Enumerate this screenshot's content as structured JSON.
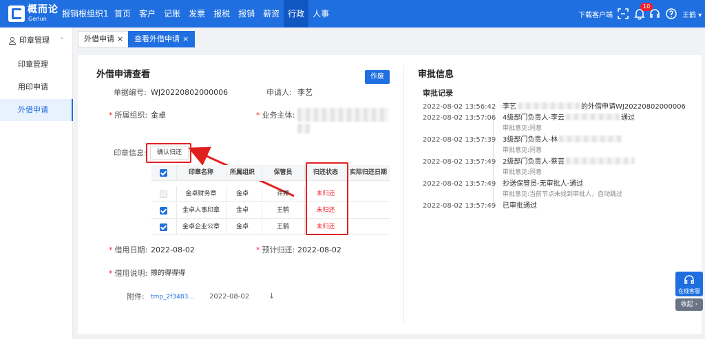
{
  "header": {
    "logo_text": "概而论",
    "logo_sub": "Gerlun",
    "org": "报销根组织1",
    "nav": [
      "首页",
      "客户",
      "记账",
      "发票",
      "报税",
      "报销",
      "薪资",
      "行政",
      "人事"
    ],
    "active_nav": "行政",
    "download": "下载客户端",
    "notif_count": "10",
    "user": "王鹤",
    "brand_color": "#1f6fe0"
  },
  "sidebar": {
    "group": "印章管理",
    "items": [
      "印章管理",
      "用印申请",
      "外借申请"
    ],
    "active": "外借申请"
  },
  "tabs": [
    {
      "label": "外借申请",
      "close": "×"
    },
    {
      "label": "查看外借申请",
      "close": "×"
    }
  ],
  "form": {
    "title": "外借申请查看",
    "void_button": "作废",
    "doc_no_label": "单据编号:",
    "doc_no": "WJ20220802000006",
    "applicant_label": "申请人:",
    "applicant": "李艺",
    "org_label": "所属组织:",
    "org": "金卓",
    "entity_label": "业务主体:",
    "seal_label": "印章信息:",
    "confirm_return": "确认归还",
    "borrow_date_label": "借用日期:",
    "borrow_date": "2022-08-02",
    "expected_return_label": "预计归还:",
    "expected_return": "2022-08-02",
    "purpose_label": "借用说明:",
    "purpose": "擦的得得得",
    "attachment_label": "附件:",
    "attachment_name": "tmp_2f3483...",
    "attachment_date": "2022-08-02",
    "download_icon": "↓"
  },
  "seal_table": {
    "headers": [
      "印章名称",
      "所属组织",
      "保管员",
      "归还状态",
      "实际归还日期"
    ],
    "rows": [
      {
        "checked": false,
        "name": "金卓财务章",
        "org": "金卓",
        "keeper": "许婷",
        "status": "未归还",
        "actual": ""
      },
      {
        "checked": true,
        "name": "金卓人事印章",
        "org": "金卓",
        "keeper": "王鹤",
        "status": "未归还",
        "actual": ""
      },
      {
        "checked": true,
        "name": "金卓企业公章",
        "org": "金卓",
        "keeper": "王鹤",
        "status": "未归还",
        "actual": ""
      }
    ]
  },
  "approval": {
    "title": "审批信息",
    "record_title": "审批记录",
    "entries": [
      {
        "time": "2022-08-02 13:56:42",
        "text": "李艺",
        "text_tail": "的外借申请WJ20220802000006",
        "sub": ""
      },
      {
        "time": "2022-08-02 13:57:06",
        "text": "4级部门负责人-李云",
        "text_tail": "通过",
        "sub": "审批意见:同意"
      },
      {
        "time": "2022-08-02 13:57:39",
        "text": "3级部门负责人-林",
        "text_tail": "",
        "sub": "审批意见:同意"
      },
      {
        "time": "2022-08-02 13:57:49",
        "text": "2级部门负责人-蔡芸",
        "text_tail": "",
        "sub": "审批意见:同意"
      },
      {
        "time": "2022-08-02 13:57:49",
        "text": "抄送保管员-无审批人-通过",
        "text_tail": "",
        "sub": "审批意见:当前节点未找到审批人，自动跳过"
      },
      {
        "time": "2022-08-02 13:57:49",
        "text": "已审批通过",
        "text_tail": "",
        "sub": ""
      }
    ]
  },
  "float": {
    "service": "在线客服",
    "fold": "收起 ›"
  }
}
